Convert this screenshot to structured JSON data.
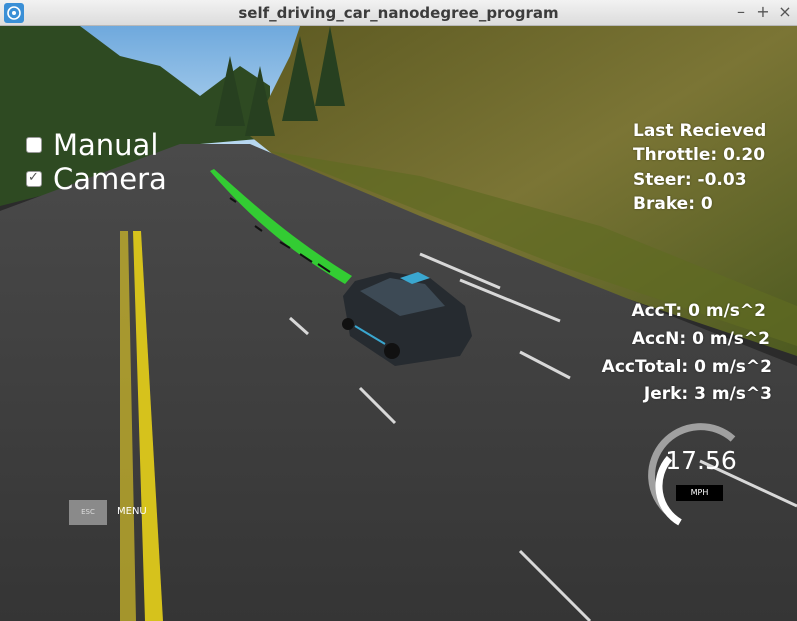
{
  "window": {
    "title": "self_driving_car_nanodegree_program",
    "controls": [
      "–",
      "+",
      "×"
    ]
  },
  "toggles": [
    {
      "label": "Manual",
      "checked": false
    },
    {
      "label": "Camera",
      "checked": true
    }
  ],
  "last_received": {
    "heading": "Last Recieved",
    "throttle": "Throttle: 0.20",
    "steer": "Steer: -0.03",
    "brake": "Brake: 0"
  },
  "accel": {
    "acc_t": "AccT: 0 m/s^2",
    "acc_n": "AccN: 0 m/s^2",
    "acc_total": "AccTotal: 0 m/s^2",
    "jerk": "Jerk: 3 m/s^3"
  },
  "speedometer": {
    "value": "17.56",
    "unit": "MPH",
    "needle_fraction": 0.35
  },
  "menu": {
    "esc_label": "ESC",
    "menu_label": "MENU"
  },
  "colors": {
    "path_green": "#33cc33",
    "lane_yellow": "#d6c21c",
    "road": "#3d3d3d",
    "grass": "#6b6a2a",
    "sky": "#8fc3ea",
    "car": "#262b30"
  }
}
